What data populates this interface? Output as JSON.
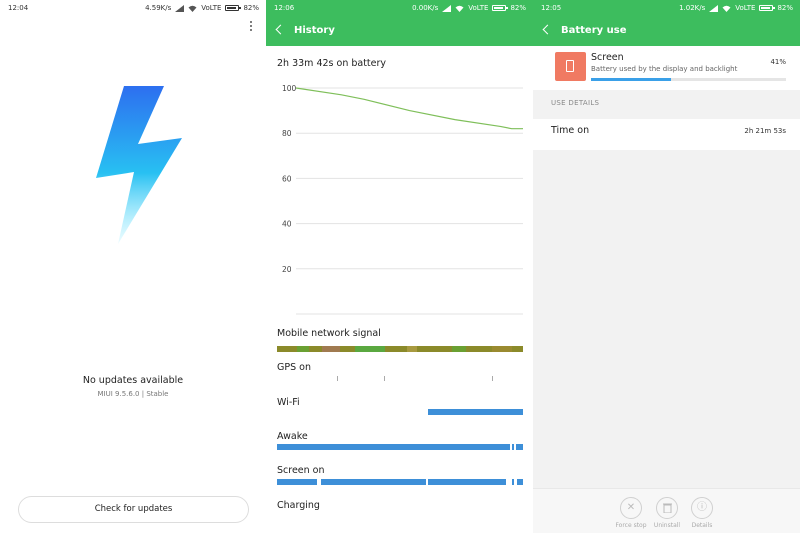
{
  "left": {
    "status": {
      "time": "12:04",
      "speed": "4.59K/s",
      "network": "VoLTE",
      "battery": "82%"
    },
    "title": "No updates available",
    "version": "MIUI 9.5.6.0 | Stable",
    "check_button": "Check for updates"
  },
  "history": {
    "status": {
      "time": "12:06",
      "speed": "0.00K/s",
      "network": "VoLTE",
      "battery": "82%"
    },
    "header": "History",
    "battery_duration": "2h 33m 42s on battery",
    "chart_data": {
      "type": "line",
      "y_ticks": [
        "100",
        "80",
        "60",
        "40",
        "20"
      ],
      "ylim": [
        0,
        100
      ],
      "x": [
        0,
        0.2,
        0.3,
        0.5,
        0.7,
        0.9,
        0.95,
        1.0
      ],
      "values": [
        100,
        97,
        95,
        90,
        86,
        83,
        82,
        82
      ],
      "color": "#7fbf5a"
    },
    "tracks": [
      {
        "label": "Mobile network signal"
      },
      {
        "label": "GPS on"
      },
      {
        "label": "Wi-Fi"
      },
      {
        "label": "Awake"
      },
      {
        "label": "Screen on"
      },
      {
        "label": "Charging"
      }
    ]
  },
  "battery_use": {
    "status": {
      "time": "12:05",
      "speed": "1.02K/s",
      "network": "VoLTE",
      "battery": "82%"
    },
    "header": "Battery use",
    "item": {
      "title": "Screen",
      "subtitle": "Battery used by the display and backlight",
      "percent": "41%",
      "fraction": 0.41
    },
    "use_details_label": "USE DETAILS",
    "time_on_label": "Time on",
    "time_on_value": "2h 21m 53s",
    "actions": [
      {
        "label": "Force stop",
        "icon": "close-icon"
      },
      {
        "label": "Uninstall",
        "icon": "trash-icon"
      },
      {
        "label": "Details",
        "icon": "info-icon"
      }
    ]
  }
}
